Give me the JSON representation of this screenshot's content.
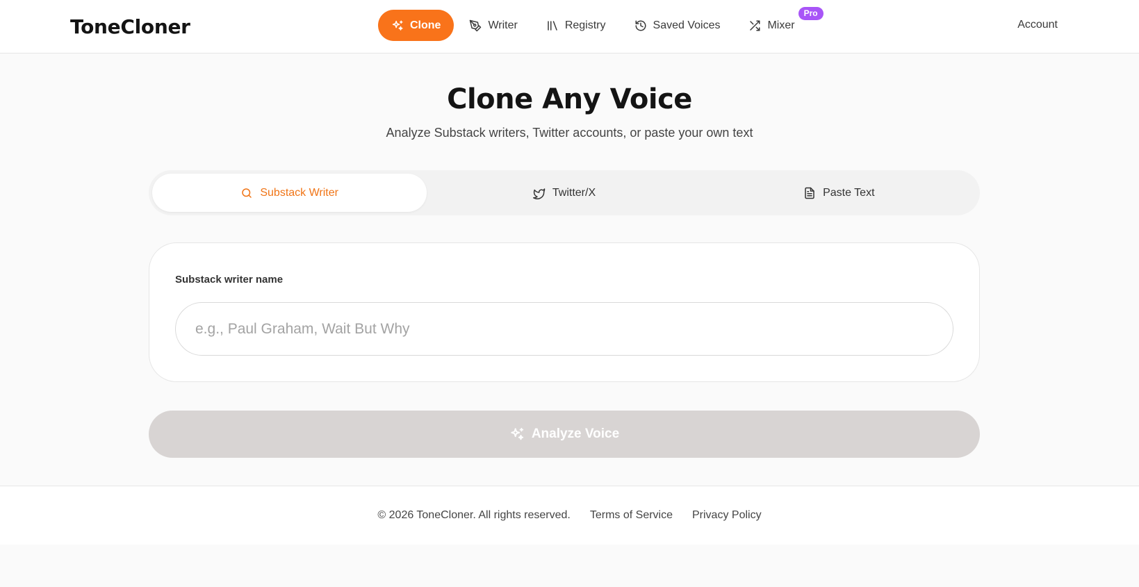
{
  "header": {
    "brand": "ToneCloner",
    "nav": [
      {
        "label": "Clone",
        "icon": "sparkles-icon",
        "active": true
      },
      {
        "label": "Writer",
        "icon": "pen-nib-icon"
      },
      {
        "label": "Registry",
        "icon": "library-icon"
      },
      {
        "label": "Saved Voices",
        "icon": "history-icon"
      },
      {
        "label": "Mixer",
        "icon": "shuffle-icon",
        "badge": "Pro"
      }
    ],
    "account": "Account"
  },
  "hero": {
    "title": "Clone Any Voice",
    "subtitle": "Analyze Substack writers, Twitter accounts, or paste your own text"
  },
  "tabs": [
    {
      "label": "Substack Writer",
      "icon": "search-icon",
      "active": true
    },
    {
      "label": "Twitter/X",
      "icon": "twitter-icon"
    },
    {
      "label": "Paste Text",
      "icon": "document-icon"
    }
  ],
  "form": {
    "label": "Substack writer name",
    "placeholder": "e.g., Paul Graham, Wait But Why",
    "value": ""
  },
  "analyze_button": {
    "label": "Analyze Voice",
    "icon": "sparkles-icon",
    "disabled": true
  },
  "footer": {
    "copyright": "© 2026 ToneCloner. All rights reserved.",
    "terms": "Terms of Service",
    "privacy": "Privacy Policy"
  },
  "colors": {
    "accent": "#f9731a",
    "accent_text": "#f07416",
    "pro_badge": "#a855f7",
    "disabled_button": "#d8d4d3"
  }
}
